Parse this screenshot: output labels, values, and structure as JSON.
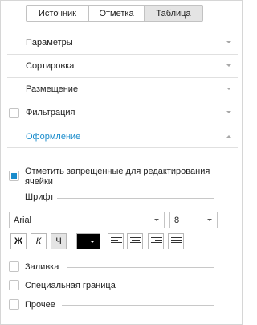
{
  "tabs": [
    {
      "label": "Источник",
      "active": false
    },
    {
      "label": "Отметка",
      "active": false
    },
    {
      "label": "Таблица",
      "active": true
    }
  ],
  "sections": [
    {
      "label": "Параметры",
      "expanded": false,
      "has_checkbox": false
    },
    {
      "label": "Сортировка",
      "expanded": false,
      "has_checkbox": false
    },
    {
      "label": "Размещение",
      "expanded": false,
      "has_checkbox": false
    },
    {
      "label": "Фильтрация",
      "expanded": false,
      "has_checkbox": true,
      "checked": false
    },
    {
      "label": "Оформление",
      "expanded": true,
      "has_checkbox": false
    }
  ],
  "design": {
    "mark_readonly_label": "Отметить запрещенные для редактирования ячейки",
    "mark_readonly_checked": true,
    "font_group_label": "Шрифт",
    "font_family": "Arial",
    "font_size": "8",
    "bold_label": "Ж",
    "italic_label": "К",
    "underline_label": "Ч",
    "underline_pressed": true,
    "font_color": "#000000",
    "fill_label": "Заливка",
    "fill_checked": false,
    "special_border_label": "Специальная граница",
    "special_border_checked": false,
    "other_label": "Прочее",
    "other_checked": false
  },
  "colors": {
    "accent": "#1a8ccc",
    "tab_active_bg": "#e4e4e4"
  }
}
